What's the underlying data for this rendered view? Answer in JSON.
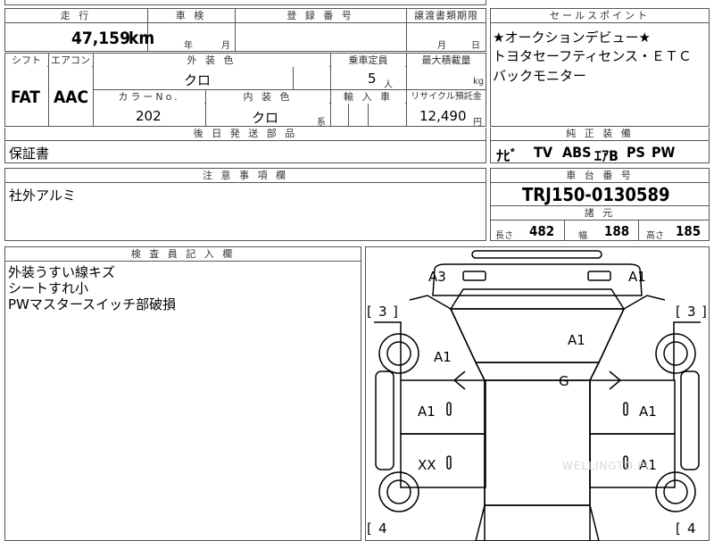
{
  "top_strip": {
    "label": ""
  },
  "row1": {
    "mileage_header": "走 行",
    "mileage_value": "47,159",
    "mileage_unit": "km",
    "inspection_header": "車 検",
    "inspection_year": "年",
    "inspection_month": "月",
    "registration_header": "登 録 番 号",
    "transfer_header": "譲渡書類期限",
    "transfer_month": "月",
    "transfer_day": "日"
  },
  "row2": {
    "shift_header": "シフト",
    "ac_header": "エアコン",
    "shift_value": "FAT",
    "ac_value": "AAC",
    "exterior_header": "外 装 色",
    "exterior_value": "クロ",
    "capacity_header": "乗車定員",
    "capacity_value": "5",
    "capacity_unit": "人",
    "load_header": "最大積載量",
    "load_unit": "kg",
    "color_no_header": "カラーNo.",
    "color_no_value": "202",
    "interior_header": "内 装 色",
    "interior_value": "クロ",
    "interior_suffix": "系",
    "import_header": "輸 入 車",
    "recycle_header": "リサイクル預託金",
    "recycle_value": "12,490",
    "recycle_unit": "円"
  },
  "later_parts": {
    "header": "後 日 発 送 部 品",
    "value": "保証書"
  },
  "notes": {
    "header": "注 意 事 項 欄",
    "value": "社外アルミ"
  },
  "inspector": {
    "header": "検 査 員 記 入 欄",
    "lines": [
      "外装うすい線キズ",
      "シートすれ小",
      "PWマスタースイッチ部破損"
    ]
  },
  "sales_points": {
    "header": "セールスポイント",
    "lines": [
      "★オークションデビュー★",
      "トヨタセーフティセンス・ＥＴＣ",
      "バックモニター"
    ]
  },
  "equipment": {
    "header": "純 正 装 備",
    "items": [
      "ﾅﾋﾞ",
      "TV",
      "ABS",
      "ｴｱB",
      "PS",
      "PW"
    ]
  },
  "chassis": {
    "header": "車 台 番 号",
    "value": "TRJ150-0130589"
  },
  "dimensions": {
    "header": "諸 元",
    "length_label": "長さ",
    "length_value": "482",
    "width_label": "幅",
    "width_value": "188",
    "height_label": "高さ",
    "height_value": "185"
  },
  "diagram": {
    "marks": {
      "front_left": "A3",
      "front_right": "A1",
      "hood": "A1",
      "left_fender": "A1",
      "roof": "G",
      "left_front_door": "A1",
      "right_front_door": "A1",
      "left_rear_door": "XX",
      "right_rear_door": "A1"
    },
    "tires": {
      "front_left": "3",
      "front_right": "3",
      "rear_left": "4",
      "rear_right": "4"
    },
    "bracket_open": "[",
    "bracket_close": "]",
    "watermark": "WELLINGTO.PL"
  }
}
